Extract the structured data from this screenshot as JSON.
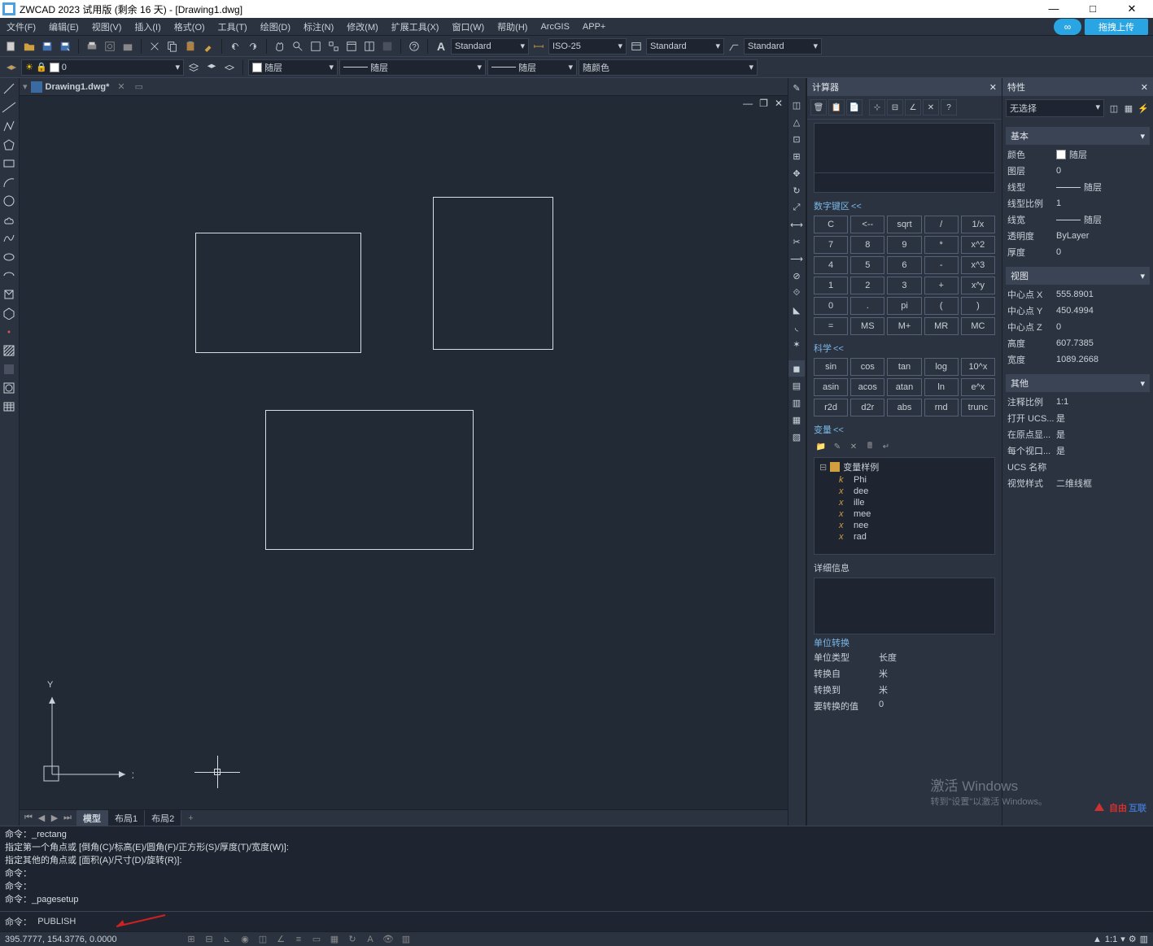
{
  "title": "ZWCAD 2023 试用版 (剩余 16 天) - [Drawing1.dwg]",
  "winControls": {
    "min": "—",
    "max": "□",
    "close": "✕"
  },
  "menu": [
    "文件(F)",
    "编辑(E)",
    "视图(V)",
    "插入(I)",
    "格式(O)",
    "工具(T)",
    "绘图(D)",
    "标注(N)",
    "修改(M)",
    "扩展工具(X)",
    "窗口(W)",
    "帮助(H)",
    "ArcGIS",
    "APP+"
  ],
  "uploadBtn": "拖拽上传",
  "styleSelectors": {
    "textStyle": "Standard",
    "dimStyle": "ISO-25",
    "tableStyle": "Standard",
    "mleaderStyle": "Standard"
  },
  "layerRow": {
    "layer": "随层",
    "lineType": "随层",
    "lineWeight": "随层",
    "color": "随颜色"
  },
  "docTab": {
    "name": "Drawing1.dwg*"
  },
  "layoutTabs": {
    "model": "模型",
    "layout1": "布局1",
    "layout2": "布局2"
  },
  "calculator": {
    "title": "计算器",
    "numPadHdr": "数字键区",
    "numKeys": [
      [
        "C",
        "<--",
        "sqrt",
        "/",
        "1/x"
      ],
      [
        "7",
        "8",
        "9",
        "*",
        "x^2"
      ],
      [
        "4",
        "5",
        "6",
        "-",
        "x^3"
      ],
      [
        "1",
        "2",
        "3",
        "+",
        "x^y"
      ],
      [
        "0",
        ".",
        "pi",
        "(",
        ")"
      ],
      [
        "=",
        "MS",
        "M+",
        "MR",
        "MC"
      ]
    ],
    "sciHdr": "科学",
    "sciKeys": [
      [
        "sin",
        "cos",
        "tan",
        "log",
        "10^x"
      ],
      [
        "asin",
        "acos",
        "atan",
        "ln",
        "e^x"
      ],
      [
        "r2d",
        "d2r",
        "abs",
        "rnd",
        "trunc"
      ]
    ],
    "varHdr": "变量",
    "varRoot": "变量样例",
    "vars": [
      "Phi",
      "dee",
      "ille",
      "mee",
      "nee",
      "rad"
    ],
    "detailHdr": "详细信息",
    "unitHdr": "单位转换",
    "unitRows": [
      {
        "lbl": "单位类型",
        "val": "长度"
      },
      {
        "lbl": "转换自",
        "val": "米"
      },
      {
        "lbl": "转换到",
        "val": "米"
      },
      {
        "lbl": "要转换的值",
        "val": "0"
      }
    ]
  },
  "properties": {
    "title": "特性",
    "noSelection": "无选择",
    "groups": {
      "basic": {
        "hdr": "基本",
        "rows": [
          {
            "lbl": "颜色",
            "val": "随层",
            "swatch": true
          },
          {
            "lbl": "图层",
            "val": "0"
          },
          {
            "lbl": "线型",
            "val": "随层",
            "line": true
          },
          {
            "lbl": "线型比例",
            "val": "1"
          },
          {
            "lbl": "线宽",
            "val": "随层",
            "line": true
          },
          {
            "lbl": "透明度",
            "val": "ByLayer"
          },
          {
            "lbl": "厚度",
            "val": "0"
          }
        ]
      },
      "view": {
        "hdr": "视图",
        "rows": [
          {
            "lbl": "中心点 X",
            "val": "555.8901"
          },
          {
            "lbl": "中心点 Y",
            "val": "450.4994"
          },
          {
            "lbl": "中心点 Z",
            "val": "0"
          },
          {
            "lbl": "高度",
            "val": "607.7385"
          },
          {
            "lbl": "宽度",
            "val": "1089.2668"
          }
        ]
      },
      "other": {
        "hdr": "其他",
        "rows": [
          {
            "lbl": "注释比例",
            "val": "1:1"
          },
          {
            "lbl": "打开 UCS...",
            "val": "是"
          },
          {
            "lbl": "在原点显...",
            "val": "是"
          },
          {
            "lbl": "每个视口...",
            "val": "是"
          },
          {
            "lbl": "UCS 名称",
            "val": ""
          },
          {
            "lbl": "视觉样式",
            "val": "二维线框"
          }
        ]
      }
    }
  },
  "cmd": {
    "lines": [
      "命令：_rectang",
      "指定第一个角点或 [倒角(C)/标高(E)/圆角(F)/正方形(S)/厚度(T)/宽度(W)]:",
      "指定其他的角点或 [面积(A)/尺寸(D)/旋转(R)]:",
      "命令：",
      "命令：",
      "命令：_pagesetup"
    ],
    "prompt": "命令：",
    "input": "PUBLISH"
  },
  "status": {
    "coords": "395.7777, 154.3776, 0.0000",
    "ratio": "1:1",
    "watermark1": "激活 Windows",
    "watermark2": "转到\"设置\"以激活 Windows。",
    "brand1": "自由",
    "brand2": "互联"
  }
}
